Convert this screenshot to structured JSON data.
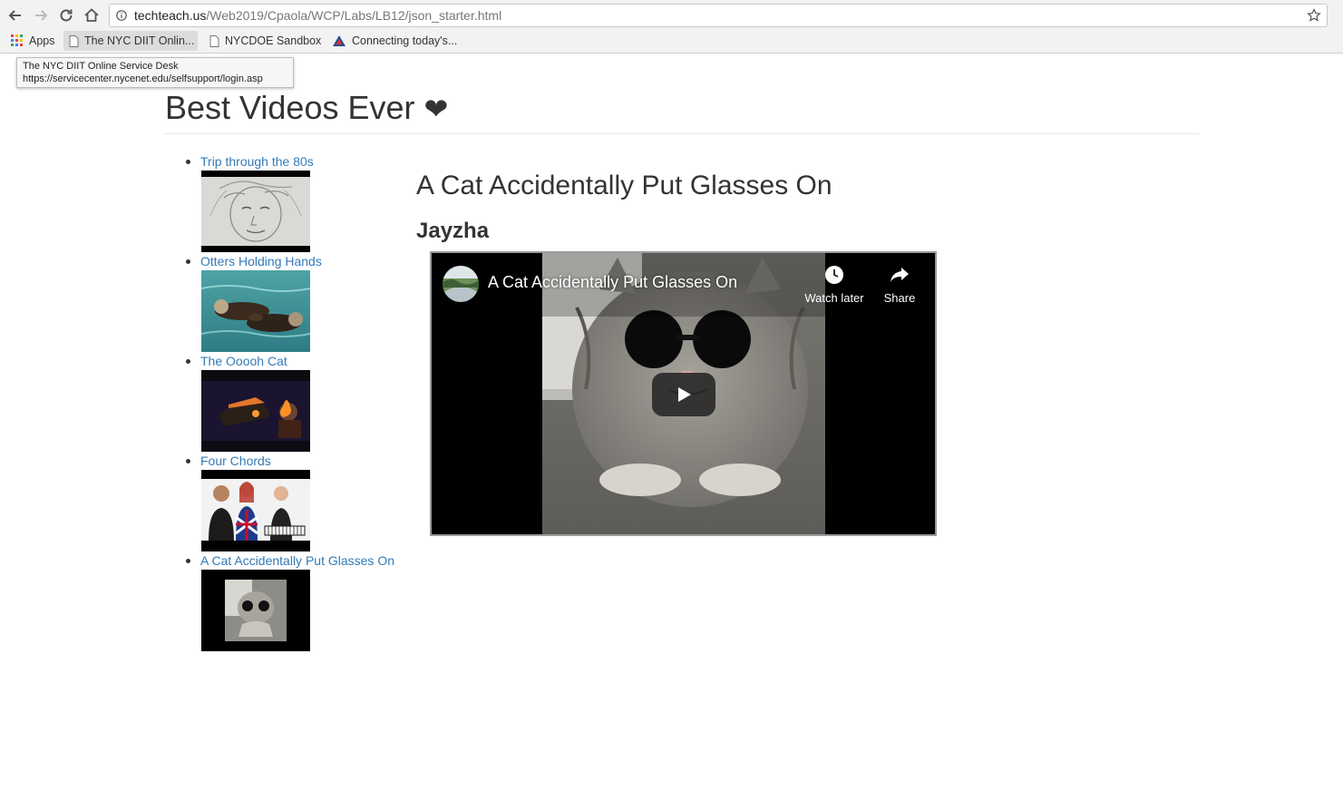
{
  "browser": {
    "url_host": "techteach.us",
    "url_path": "/Web2019/Cpaola/WCP/Labs/LB12/json_starter.html",
    "bookmarks": [
      {
        "label": "Apps",
        "icon": "apps-grid-icon"
      },
      {
        "label": "The NYC DIIT Onlin...",
        "icon": "page-icon"
      },
      {
        "label": "NYCDOE Sandbox",
        "icon": "page-icon"
      },
      {
        "label": "Connecting today's...",
        "icon": "site-logo-icon"
      }
    ],
    "tooltip": {
      "title": "The NYC DIIT Online Service Desk",
      "url": "https://servicecenter.nycenet.edu/selfsupport/login.asp"
    }
  },
  "page": {
    "title": "Best Videos Ever",
    "heart": "❤"
  },
  "videos": [
    {
      "title": "Trip through the 80s"
    },
    {
      "title": "Otters Holding Hands"
    },
    {
      "title": "The Ooooh Cat"
    },
    {
      "title": "Four Chords"
    },
    {
      "title": "A Cat Accidentally Put Glasses On"
    }
  ],
  "selected": {
    "title": "A Cat Accidentally Put Glasses On",
    "author": "Jayzha",
    "player": {
      "title": "A Cat Accidentally Put Glasses On",
      "watch_later_label": "Watch later",
      "share_label": "Share"
    }
  },
  "colors": {
    "link": "#337ab7",
    "text": "#333333",
    "player_bg": "#000000"
  }
}
